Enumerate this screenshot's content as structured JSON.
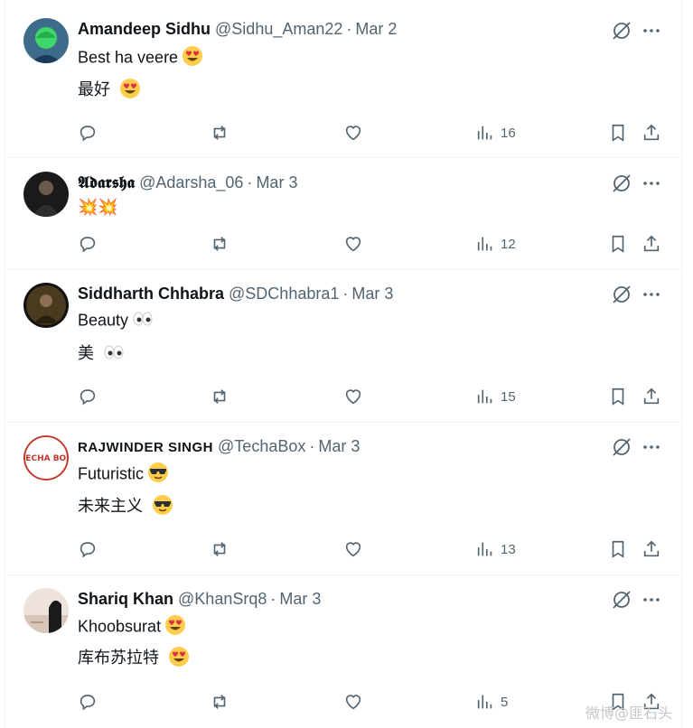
{
  "colors": {
    "text": "#0f1419",
    "secondary": "#536471",
    "divider": "#eff3f4"
  },
  "tweets": [
    {
      "name": "Amandeep Sidhu",
      "handle": "@Sidhu_Aman22",
      "sep": "·",
      "date": "Mar 2",
      "line1": "Best ha veere",
      "line1_emoji": "heart-eyes",
      "line2": "最好",
      "line2_emoji": "heart-eyes",
      "views": "16"
    },
    {
      "name": "𝕬𝖉𝖆𝖗𝖘𝖍𝖆",
      "handle": "@Adarsha_06",
      "sep": "·",
      "date": "Mar 3",
      "line1": "💥💥",
      "line1_emoji": "",
      "line2": "",
      "line2_emoji": "",
      "views": "12"
    },
    {
      "name": "Siddharth Chhabra",
      "handle": "@SDChhabra1",
      "sep": "·",
      "date": "Mar 3",
      "line1": "Beauty",
      "line1_emoji": "eyes",
      "line2": "美",
      "line2_emoji": "eyes",
      "views": "15"
    },
    {
      "name": "RAJWINDER SINGH",
      "handle": "@TechaBox",
      "sep": "·",
      "date": "Mar 3",
      "line1": "Futuristic",
      "line1_emoji": "sunglasses",
      "line2": "未来主义",
      "line2_emoji": "sunglasses",
      "views": "13"
    },
    {
      "name": "Shariq Khan",
      "handle": "@KhanSrq8",
      "sep": "·",
      "date": "Mar 3",
      "line1": "Khoobsurat",
      "line1_emoji": "heart-eyes",
      "line2": "库布苏拉特",
      "line2_emoji": "heart-eyes",
      "views": "5"
    }
  ],
  "avatar_text": {
    "techa_box": "TECHA BOX"
  },
  "watermark": "微博@匪石头"
}
